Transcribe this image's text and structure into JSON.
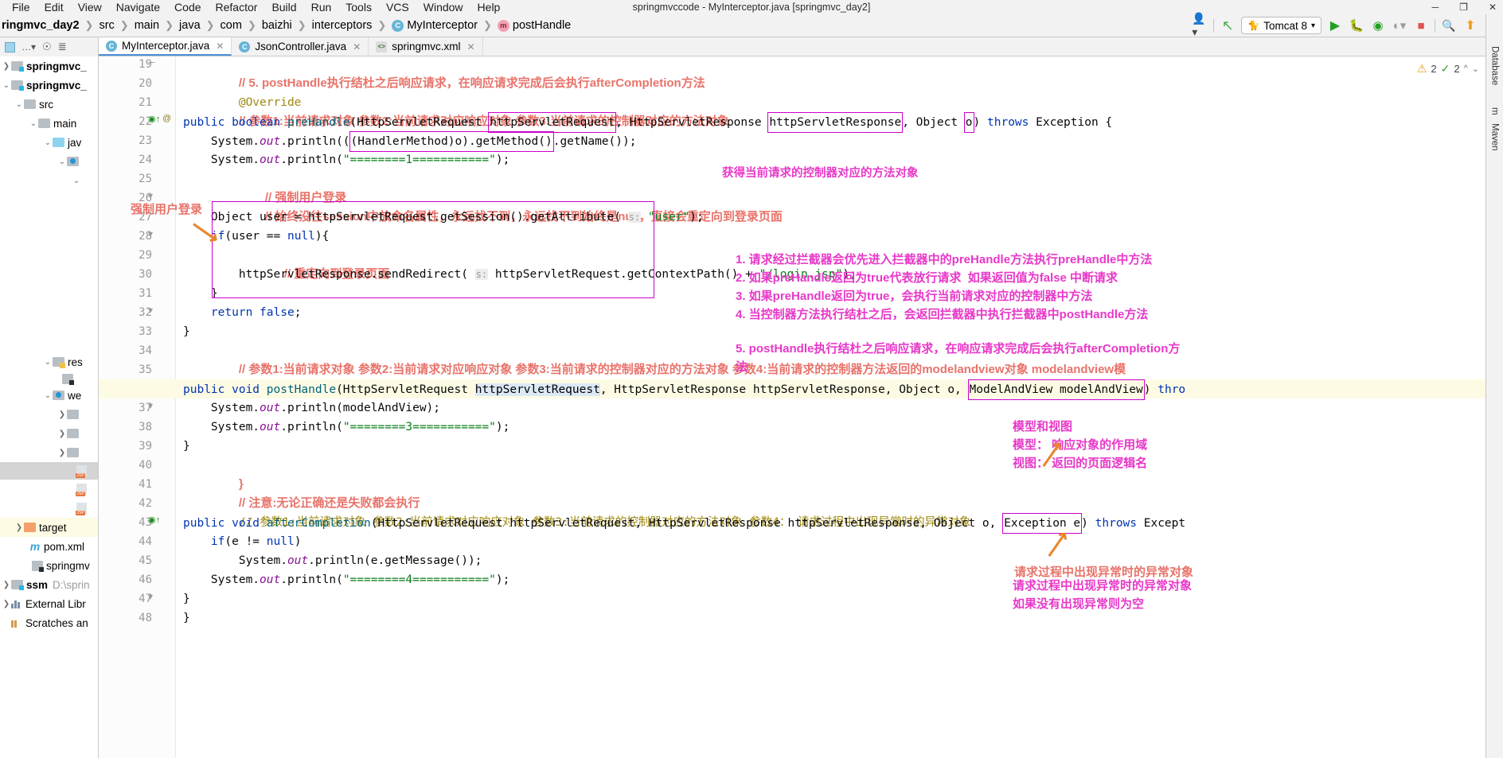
{
  "window": {
    "title": "springmvccode - MyInterceptor.java [springmvc_day2]",
    "controls": [
      "─",
      "❐",
      "✕"
    ]
  },
  "menu": [
    "File",
    "Edit",
    "View",
    "Navigate",
    "Code",
    "Refactor",
    "Build",
    "Run",
    "Tools",
    "VCS",
    "Window",
    "Help"
  ],
  "breadcrumb": [
    {
      "label": "ringmvc_day2",
      "bold": true,
      "icon": ""
    },
    {
      "label": "src",
      "bold": false,
      "icon": ""
    },
    {
      "label": "main",
      "bold": false,
      "icon": ""
    },
    {
      "label": "java",
      "bold": false,
      "icon": ""
    },
    {
      "label": "com",
      "bold": false,
      "icon": ""
    },
    {
      "label": "baizhi",
      "bold": false,
      "icon": ""
    },
    {
      "label": "interceptors",
      "bold": false,
      "icon": ""
    },
    {
      "label": "MyInterceptor",
      "bold": false,
      "icon": "class-icon"
    },
    {
      "label": "postHandle",
      "bold": false,
      "icon": "method-icon"
    }
  ],
  "toolbar": {
    "run_config": "Tomcat 8",
    "icons": [
      "user-icon",
      "undo-icon",
      "run-icon",
      "debug-icon",
      "run-coverage-icon",
      "profile-icon",
      "stop-icon",
      "search-icon",
      "update-icon",
      "ide-icon"
    ]
  },
  "tabs": [
    {
      "label": "MyInterceptor.java",
      "icon": "java-class-icon",
      "active": true
    },
    {
      "label": "JsonController.java",
      "icon": "java-class-icon",
      "active": false
    },
    {
      "label": "springmvc.xml",
      "icon": "xml-file-icon",
      "active": false
    }
  ],
  "inspection": {
    "warnings": "2",
    "checks": "2"
  },
  "project_tree": [
    {
      "indent": 0,
      "arrow": "›",
      "icon": "module-folder",
      "label": "springmvc_",
      "bold": true
    },
    {
      "indent": 0,
      "arrow": "⌄",
      "icon": "module-folder",
      "label": "springmvc_",
      "bold": true
    },
    {
      "indent": 1,
      "arrow": "⌄",
      "icon": "folder",
      "label": "src",
      "bold": false
    },
    {
      "indent": 2,
      "arrow": "⌄",
      "icon": "folder",
      "label": "main",
      "bold": false
    },
    {
      "indent": 3,
      "arrow": "⌄",
      "icon": "folder-blue",
      "label": "jav",
      "bold": false
    },
    {
      "indent": 4,
      "arrow": "⌄",
      "icon": "folder",
      "label": "",
      "bold": false
    },
    {
      "indent": 5,
      "arrow": "⌄",
      "icon": "",
      "label": "",
      "bold": false
    },
    {
      "indent": 3,
      "arrow": "⌄",
      "icon": "folder-res",
      "label": "res",
      "bold": false
    },
    {
      "indent": 4,
      "arrow": "",
      "icon": "xml-file",
      "label": "",
      "bold": false
    },
    {
      "indent": 3,
      "arrow": "⌄",
      "icon": "folder-web",
      "label": "we",
      "bold": false
    },
    {
      "indent": 4,
      "arrow": "›",
      "icon": "folder",
      "label": "",
      "bold": false
    },
    {
      "indent": 4,
      "arrow": "›",
      "icon": "folder",
      "label": "",
      "bold": false
    },
    {
      "indent": 4,
      "arrow": "›",
      "icon": "folder",
      "label": "",
      "bold": false
    },
    {
      "indent": 4,
      "arrow": "",
      "icon": "jsp-file",
      "label": "",
      "bold": false,
      "selected": true
    },
    {
      "indent": 4,
      "arrow": "",
      "icon": "jsp-file",
      "label": "",
      "bold": false
    },
    {
      "indent": 4,
      "arrow": "",
      "icon": "jsp-file",
      "label": "",
      "bold": false
    },
    {
      "indent": 1,
      "arrow": "›",
      "icon": "folder-orange",
      "label": "target",
      "bold": false,
      "highlight": true
    },
    {
      "indent": 2,
      "arrow": "",
      "icon": "maven-file",
      "label": "pom.xml",
      "bold": false
    },
    {
      "indent": 2,
      "arrow": "",
      "icon": "iml-file",
      "label": "springmv",
      "bold": false
    },
    {
      "indent": 0,
      "arrow": "›",
      "icon": "module-folder",
      "label": "ssm",
      "bold": true,
      "path": "D:\\sprin"
    },
    {
      "indent": 0,
      "arrow": "›",
      "icon": "library",
      "label": "External Libr",
      "bold": false
    },
    {
      "indent": 0,
      "arrow": "",
      "icon": "scratch",
      "label": "Scratches an",
      "bold": false
    }
  ],
  "code_lines": [
    {
      "n": "19",
      "text": "// 5. postHandle执行结杜之后响应请求，在响应请求完成后会执行afterCompletion方法",
      "type": "comment-red"
    },
    {
      "n": "20",
      "text": "@Override",
      "type": "annotation"
    },
    {
      "n": "21",
      "text": "// 参数1:当前请求对象 参数2:当前请求对应响应对象 参数3:当前请求的控制器对应的方法对象",
      "type": "comment-red"
    },
    {
      "n": "22",
      "text": "public boolean preHandle(HttpServletRequest httpServletRequest, HttpServletResponse httpServletResponse, Object o) throws Exception {",
      "type": "code"
    },
    {
      "n": "23",
      "text": "System.out.println(((HandlerMethod)o).getMethod().getName());",
      "type": "code"
    },
    {
      "n": "24",
      "text": "System.out.println(\"========1===========\");",
      "type": "code"
    },
    {
      "n": "25",
      "text": "// 强制用户登录",
      "type": "comment-red"
    },
    {
      "n": "26",
      "text": "// 始终没往session中放命名属性，永远找不到，永远找不到始终是null，直接会重定向到登录页面",
      "type": "comment-red"
    },
    {
      "n": "27",
      "text": "Object user = httpServletRequest.getSession().getAttribute( s: \"user\");",
      "type": "code"
    },
    {
      "n": "28",
      "text": "if(user == null){",
      "type": "code"
    },
    {
      "n": "29",
      "text": "// 重定向到登录页面",
      "type": "comment-red"
    },
    {
      "n": "30",
      "text": "httpServletResponse.sendRedirect( s: httpServletRequest.getContextPath() + \"/login.jsp\");",
      "type": "code"
    },
    {
      "n": "31",
      "text": "}",
      "type": "code"
    },
    {
      "n": "32",
      "text": "return false;",
      "type": "code"
    },
    {
      "n": "33",
      "text": "}",
      "type": "code"
    },
    {
      "n": "34",
      "text": "// 参数1:当前请求对象 参数2:当前请求对应响应对象 参数3:当前请求的控制器对应的方法对象 参数4:当前请求的控制器方法返回的modelandview对象 modelandview模",
      "type": "comment-red"
    },
    {
      "n": "35",
      "text": "@Override",
      "type": "annotation"
    },
    {
      "n": "36",
      "text": "public void postHandle(HttpServletRequest httpServletRequest, HttpServletResponse httpServletResponse, Object o, ModelAndView modelAndView) throws",
      "type": "code",
      "highlight": true
    },
    {
      "n": "37",
      "text": "System.out.println(modelAndView);",
      "type": "code"
    },
    {
      "n": "38",
      "text": "System.out.println(\"========3===========\");",
      "type": "code"
    },
    {
      "n": "39",
      "text": "}",
      "type": "code"
    },
    {
      "n": "40",
      "text": "// 注意:无论正确还是失败都会执行",
      "type": "comment-red"
    },
    {
      "n": "41",
      "text": "// 参数1:当前请求对象 参数2:当前请求对应响应对象 参数3:当前请求的控制器对应的方法对象 参数4： 请求过程中出现异常时的异常对象",
      "type": "comment-red"
    },
    {
      "n": "42",
      "text": "@Override",
      "type": "annotation"
    },
    {
      "n": "43",
      "text": "public void afterCompletion(HttpServletRequest httpServletRequest, HttpServletResponse httpServletResponse, Object o, Exception e) throws Except",
      "type": "code"
    },
    {
      "n": "44",
      "text": "if(e != null)",
      "type": "code"
    },
    {
      "n": "45",
      "text": "System.out.println(e.getMessage());",
      "type": "code"
    },
    {
      "n": "46",
      "text": "System.out.println(\"========4===========\");",
      "type": "code"
    },
    {
      "n": "47",
      "text": "}",
      "type": "code"
    },
    {
      "n": "48",
      "text": "}",
      "type": "code"
    }
  ],
  "annotations": {
    "left_label": "强制用户登录",
    "method_object": "获得当前请求的控制器对应的方法对象",
    "numbered": [
      "1. 请求经过拦截器会优先进入拦截器中的preHandle方法执行preHandle中方法",
      "2. 如果preHandle返回为true代表放行请求  如果返回值为false 中断请求",
      "3. 如果preHandle返回为true，会执行当前请求对应的控制器中方法",
      "4. 当控制器方法执行结杜之后，会返回拦截器中执行拦截器中postHandle方法",
      "5. postHandle执行结杜之后响应请求，在响应请求完成后会执行afterCompletion方",
      "法"
    ],
    "model_view": [
      "模型和视图",
      "模型： 响应对象的作用域",
      "视图： 返回的页面逻辑名"
    ],
    "exception_note_red": "请求过程中出现异常时的异常对象",
    "exception_note": [
      "请求过程中出现异常时的异常对象",
      "如果没有出现异常则为空"
    ]
  },
  "right_toolbar": [
    "Database",
    "m",
    "Maven"
  ]
}
